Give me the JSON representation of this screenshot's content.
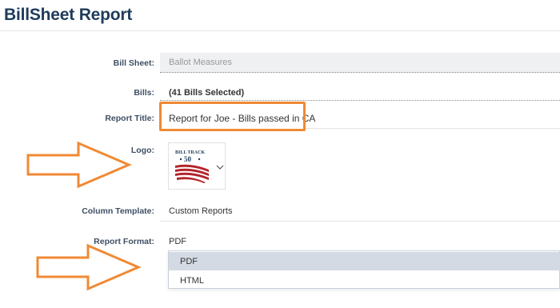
{
  "header": {
    "title": "BillSheet Report"
  },
  "form": {
    "bill_sheet": {
      "label": "Bill Sheet:",
      "value": "Ballot Measures"
    },
    "bills": {
      "label": "Bills:",
      "value": "(41 Bills Selected)"
    },
    "report_title": {
      "label": "Report Title:",
      "value": "Report for Joe - Bills passed in CA"
    },
    "logo": {
      "label": "Logo:",
      "logo_text_top": "BILL TRACK",
      "logo_text_num": "50",
      "dropdown_icon": "chevron-down-icon"
    },
    "column_template": {
      "label": "Column Template:",
      "value": "Custom Reports"
    },
    "report_format": {
      "label": "Report Format:",
      "value": "PDF",
      "options": [
        "PDF",
        "HTML"
      ],
      "selected_index": 0
    }
  },
  "annotations": {
    "highlight_color": "#f08a34",
    "arrows": [
      "arrow-right-icon",
      "arrow-right-icon"
    ]
  },
  "colors": {
    "title": "#1f3b5c",
    "label": "#3f4f63",
    "selected_option_bg": "#d3dae3",
    "logo_red": "#b3242c",
    "logo_navy": "#1f3b5c"
  }
}
